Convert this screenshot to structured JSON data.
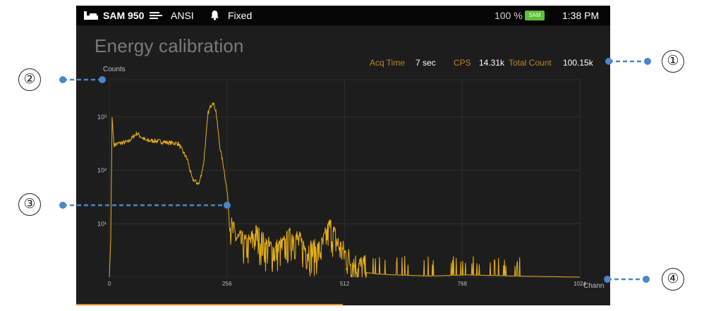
{
  "statusbar": {
    "device": "SAM 950",
    "standard": "ANSI",
    "mode": "Fixed",
    "battery": "100 %",
    "battery_badge": "SAM",
    "time": "1:38 PM",
    "icons": [
      "device-icon",
      "signal-icon",
      "bell-icon",
      "battery-icon"
    ]
  },
  "page": {
    "title": "Energy calibration"
  },
  "metrics": {
    "acq_time_label": "Acq Time",
    "acq_time_value": "7 sec",
    "cps_label": "CPS",
    "cps_value": "14.31k",
    "total_count_label": "Total Count",
    "total_count_value": "100.15k"
  },
  "callouts": [
    "①",
    "②",
    "③",
    "④"
  ],
  "colors": {
    "spectrum": "#e8b019",
    "accent": "#b8862a",
    "battery": "#5fbf3a",
    "grid": "#2e2e2e"
  },
  "chart_data": {
    "type": "line",
    "ylabel": "Counts",
    "xlabel": "Chann",
    "yscale": "log",
    "x_ticks": [
      0,
      256,
      512,
      768,
      1024
    ],
    "y_ticks": [
      "10¹",
      "10²",
      "10³"
    ],
    "y_tick_values": [
      10,
      100,
      1000
    ],
    "xlim": [
      0,
      1024
    ],
    "ylim": [
      1,
      5000
    ],
    "grid": true,
    "series": [
      {
        "x": [
          0,
          3,
          6,
          10,
          20,
          40,
          60,
          70,
          80,
          100,
          130,
          150,
          170,
          180,
          195,
          205,
          215,
          225,
          232,
          240,
          250,
          258,
          262,
          268,
          280,
          300,
          320,
          340,
          360,
          380,
          400,
          420,
          440,
          460,
          480,
          500,
          520,
          540,
          580,
          620,
          700,
          780,
          880,
          1024
        ],
        "y": [
          1,
          5,
          1000,
          300,
          320,
          340,
          500,
          420,
          360,
          360,
          330,
          320,
          160,
          70,
          55,
          130,
          1200,
          2000,
          1300,
          300,
          100,
          30,
          8,
          6,
          4,
          3,
          5,
          3,
          2.5,
          3,
          5,
          3,
          2.5,
          2.5,
          7,
          3,
          1.8,
          1.3,
          1.15,
          1.1,
          1.05,
          1.1,
          1.05,
          1
        ]
      }
    ]
  }
}
